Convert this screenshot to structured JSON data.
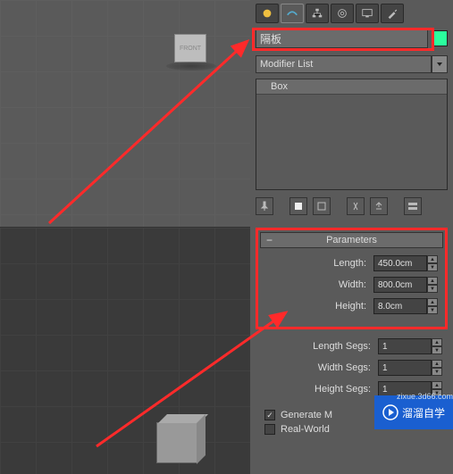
{
  "viewport": {
    "front_label": "FRONT"
  },
  "tabs": {
    "icons": [
      "sun-icon",
      "arc-icon",
      "hierarchy-icon",
      "spiral-icon",
      "display-icon",
      "utilities-icon"
    ]
  },
  "object": {
    "name": "隔板",
    "color": "#2bff9e"
  },
  "modifier": {
    "list_label": "Modifier List",
    "stack_item": "Box"
  },
  "stack_tools": {
    "items": [
      "pin-icon",
      "show-end-icon",
      "make-unique-icon",
      "remove-icon",
      "configure-icon"
    ]
  },
  "parameters": {
    "title": "Parameters",
    "length_label": "Length:",
    "length_value": "450.0cm",
    "width_label": "Width:",
    "width_value": "800.0cm",
    "height_label": "Height:",
    "height_value": "8.0cm",
    "length_segs_label": "Length Segs:",
    "length_segs_value": "1",
    "width_segs_label": "Width Segs:",
    "width_segs_value": "1",
    "height_segs_label": "Height Segs:",
    "height_segs_value": "1",
    "generate_label": "Generate M",
    "realworld_label": "Real-World"
  },
  "watermark": {
    "text": "溜溜自学",
    "sub": "zixue.3d66.com"
  }
}
